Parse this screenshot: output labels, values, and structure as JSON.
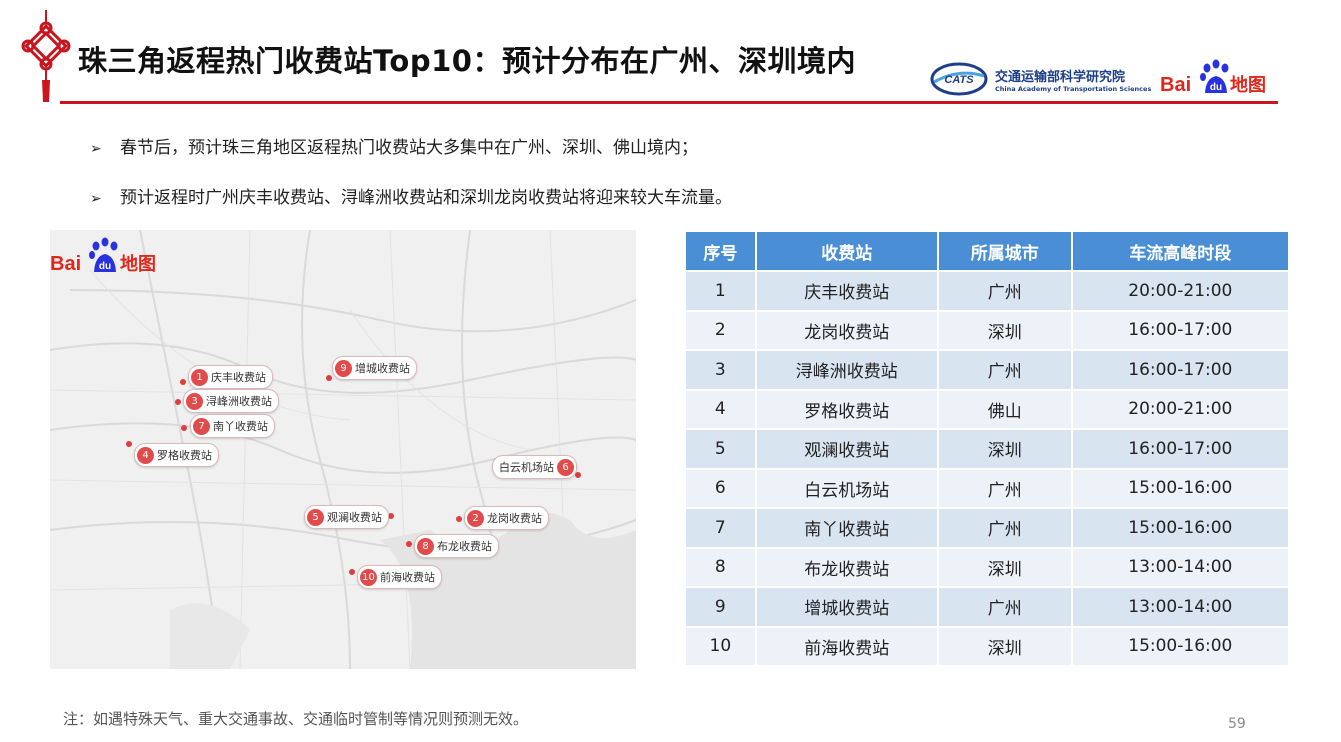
{
  "header": {
    "title": "珠三角返程热门收费站Top10：预计分布在广州、深圳境内",
    "org_cn": "交通运输部科学研究院",
    "org_en": "China Academy of Transportation Sciences",
    "cats_abbr": "CATS",
    "baidu_logo_text": "Bai du 地图"
  },
  "bullets": [
    "春节后，预计珠三角地区返程热门收费站大多集中在广州、深圳、佛山境内；",
    "预计返程时广州庆丰收费站、浔峰洲收费站和深圳龙岗收费站将迎来较大车流量。"
  ],
  "map": {
    "logo_text": "Bai du 地图",
    "markers": [
      {
        "num": "1",
        "label": "庆丰收费站"
      },
      {
        "num": "2",
        "label": "龙岗收费站"
      },
      {
        "num": "3",
        "label": "浔峰洲收费站"
      },
      {
        "num": "4",
        "label": "罗格收费站"
      },
      {
        "num": "5",
        "label": "观澜收费站"
      },
      {
        "num": "6",
        "label": "白云机场站"
      },
      {
        "num": "7",
        "label": "南丫收费站"
      },
      {
        "num": "8",
        "label": "布龙收费站"
      },
      {
        "num": "9",
        "label": "增城收费站"
      },
      {
        "num": "10",
        "label": "前海收费站"
      }
    ]
  },
  "table": {
    "headers": [
      "序号",
      "收费站",
      "所属城市",
      "车流高峰时段"
    ],
    "rows": [
      [
        "1",
        "庆丰收费站",
        "广州",
        "20:00-21:00"
      ],
      [
        "2",
        "龙岗收费站",
        "深圳",
        "16:00-17:00"
      ],
      [
        "3",
        "浔峰洲收费站",
        "广州",
        "16:00-17:00"
      ],
      [
        "4",
        "罗格收费站",
        "佛山",
        "20:00-21:00"
      ],
      [
        "5",
        "观澜收费站",
        "深圳",
        "16:00-17:00"
      ],
      [
        "6",
        "白云机场站",
        "广州",
        "15:00-16:00"
      ],
      [
        "7",
        "南丫收费站",
        "广州",
        "15:00-16:00"
      ],
      [
        "8",
        "布龙收费站",
        "深圳",
        "13:00-14:00"
      ],
      [
        "9",
        "增城收费站",
        "广州",
        "13:00-14:00"
      ],
      [
        "10",
        "前海收费站",
        "深圳",
        "15:00-16:00"
      ]
    ]
  },
  "footer": {
    "note": "注：如遇特殊天气、重大交通事故、交通临时管制等情况则预测无效。",
    "page_number": "59"
  },
  "colors": {
    "accent_red": "#c9151e",
    "table_header": "#4a8fd6",
    "row_odd": "#d9e4f1",
    "row_even": "#edf2f9",
    "marker_red": "#e24b4b",
    "baidu_red": "#e1261c",
    "baidu_blue": "#2932e1"
  }
}
